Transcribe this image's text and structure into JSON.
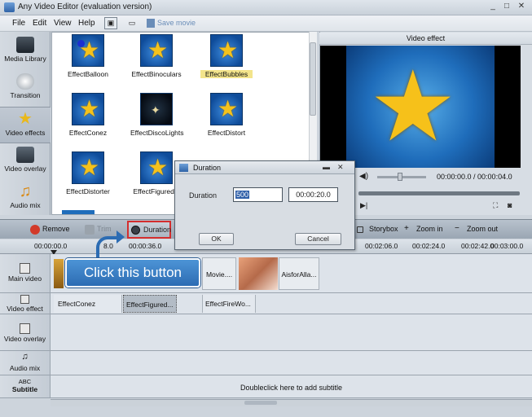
{
  "window": {
    "title": "Any Video Editor (evaluation version)",
    "min": "_",
    "max": "□",
    "close": "✕"
  },
  "menu": {
    "items": [
      "File",
      "Edit",
      "View",
      "Help"
    ],
    "save_label": "Save movie"
  },
  "sidebar": {
    "items": [
      {
        "label": "Media Library",
        "icon": "film-icon"
      },
      {
        "label": "Transition",
        "icon": "disc-icon"
      },
      {
        "label": "Video effects",
        "icon": "star-icon"
      },
      {
        "label": "Video overlay",
        "icon": "overlay-icon"
      },
      {
        "label": "Audio mix",
        "icon": "music-note-icon"
      }
    ]
  },
  "library": {
    "effects": [
      "EffectBalloon",
      "EffectBinoculars",
      "EffectBubbles",
      "EffectConez",
      "EffectDiscoLights",
      "EffectDistort",
      "EffectDistorter",
      "EffectFiguredG",
      "EffectFireWo"
    ],
    "selected": "EffectBubbles"
  },
  "preview": {
    "title": "Video effect",
    "time": "00:00:00.0 / 00:00:04.0"
  },
  "timeline_toolbar": {
    "remove": "Remove",
    "trim": "Trim",
    "duration": "Duration",
    "storybox": "Storybox",
    "zoom_in": "Zoom in",
    "zoom_out": "Zoom out"
  },
  "ruler": {
    "ticks": [
      "00:00:00.0",
      "8.0",
      "00:00:36.0",
      "00:02:06.0",
      "00:02:24.0",
      "00:02:42.0",
      "00:03:00.0"
    ]
  },
  "tracks": {
    "main_video": "Main video",
    "video_effect": "Video effect",
    "video_overlay": "Video overlay",
    "audio_mix": "Audio mix",
    "subtitle": "Subtitle",
    "subtitle_abc": "ABC",
    "main_clips": [
      "Movie....",
      "AisforAlla..."
    ],
    "effect_clips": [
      "EffectConez",
      "EffectFigured...",
      "EffectFireWo..."
    ],
    "subtitle_hint": "Doubleclick here to add subtitle"
  },
  "callout": {
    "text": "Click this button"
  },
  "dialog": {
    "title": "Duration",
    "label": "Duration",
    "frames_value": "500",
    "time_value": "00:00:20.0",
    "ok": "OK",
    "cancel": "Cancel"
  }
}
